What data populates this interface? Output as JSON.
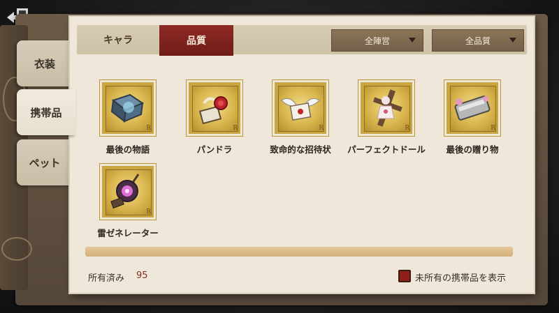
{
  "nav": {
    "back_icon": "exit-door-icon"
  },
  "side_tabs": [
    {
      "label": "衣装"
    },
    {
      "label": "携帯品"
    },
    {
      "label": "ペット"
    }
  ],
  "top_tabs": [
    {
      "label": "キャラ"
    },
    {
      "label": "品質"
    }
  ],
  "filters": {
    "faction": "全陣営",
    "quality": "全品質"
  },
  "items": [
    {
      "name": "最後の物語",
      "icon": "book-icon"
    },
    {
      "name": "パンドラ",
      "icon": "rose-box-icon"
    },
    {
      "name": "致命的な招待状",
      "icon": "winged-letter-icon"
    },
    {
      "name": "パーフェクトドール",
      "icon": "doll-icon"
    },
    {
      "name": "最後の贈り物",
      "icon": "gift-case-icon"
    },
    {
      "name": "雷ゼネレーター",
      "icon": "generator-icon"
    }
  ],
  "stamp_mark": "R",
  "footer": {
    "owned_label": "所有済み",
    "owned_count": "95",
    "show_unowned_label": "未所有の携帯品を表示"
  },
  "colors": {
    "accent_red": "#8f2a25",
    "stamp_gold": "#c9a640",
    "paper": "#efe8da"
  }
}
